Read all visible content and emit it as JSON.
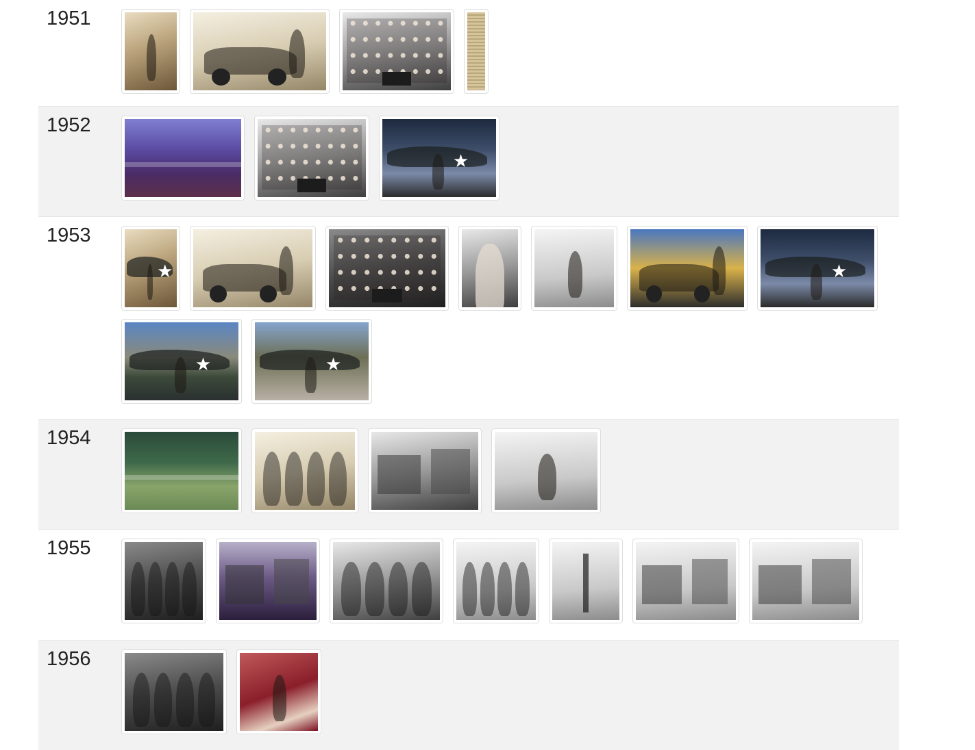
{
  "timeline": {
    "rows": [
      {
        "year": "1951",
        "photos": [
          {
            "name": "soldier-walking-photo",
            "tone": "sepia",
            "motif": "figure"
          },
          {
            "name": "people-by-car-photo",
            "tone": "lightsepia",
            "motif": "car"
          },
          {
            "name": "school-class-photo",
            "tone": "bw",
            "motif": "class"
          },
          {
            "name": "newspaper-clipping-photo",
            "tone": "news",
            "motif": "none"
          }
        ]
      },
      {
        "year": "1952",
        "photos": [
          {
            "name": "rodeo-field-photo",
            "tone": "purple",
            "motif": "field"
          },
          {
            "name": "school-class-photo",
            "tone": "bw",
            "motif": "class"
          },
          {
            "name": "soldier-with-airplane-photo",
            "tone": "color3",
            "motif": "plane"
          }
        ]
      },
      {
        "year": "1953",
        "photos": [
          {
            "name": "small-airplane-photo",
            "tone": "sepia",
            "motif": "plane"
          },
          {
            "name": "soldier-with-jeep-photo",
            "tone": "lightsepia",
            "motif": "jeep"
          },
          {
            "name": "school-class-photo",
            "tone": "bwdark",
            "motif": "class"
          },
          {
            "name": "soldier-portrait-photo",
            "tone": "bw",
            "motif": "portrait"
          },
          {
            "name": "soldier-by-tent-photo",
            "tone": "bwpale",
            "motif": "figure"
          },
          {
            "name": "soldier-with-yellow-jeep-photo",
            "tone": "color2",
            "motif": "jeep"
          },
          {
            "name": "airplane-22-photo",
            "tone": "color3",
            "motif": "plane"
          },
          {
            "name": "us-army-airplane-photo",
            "tone": "color1",
            "motif": "plane"
          },
          {
            "name": "soldier-by-airplane-photo",
            "tone": "color5",
            "motif": "plane"
          }
        ]
      },
      {
        "year": "1954",
        "photos": [
          {
            "name": "mill-pond-photo",
            "tone": "forest",
            "motif": "field"
          },
          {
            "name": "family-group-photo",
            "tone": "lightsepia",
            "motif": "family"
          },
          {
            "name": "farm-buildings-photo",
            "tone": "bw",
            "motif": "buildings"
          },
          {
            "name": "woman-in-field-photo",
            "tone": "bwpale",
            "motif": "figure"
          }
        ]
      },
      {
        "year": "1955",
        "photos": [
          {
            "name": "couple-portrait-photo",
            "tone": "bwdark",
            "motif": "family"
          },
          {
            "name": "sawmill-photo",
            "tone": "purplebw",
            "motif": "buildings"
          },
          {
            "name": "family-outdoors-photo",
            "tone": "bw",
            "motif": "family"
          },
          {
            "name": "wedding-couple-photo",
            "tone": "bwpale",
            "motif": "family"
          },
          {
            "name": "bare-tree-photo",
            "tone": "bwpale",
            "motif": "tree"
          },
          {
            "name": "town-street-photo",
            "tone": "bwpale",
            "motif": "buildings"
          },
          {
            "name": "church-building-photo",
            "tone": "bwpale",
            "motif": "buildings"
          }
        ]
      },
      {
        "year": "1956",
        "photos": [
          {
            "name": "family-group-photo",
            "tone": "bwdark",
            "motif": "family"
          },
          {
            "name": "woman-in-kitchen-photo",
            "tone": "red",
            "motif": "figure"
          }
        ]
      }
    ]
  }
}
